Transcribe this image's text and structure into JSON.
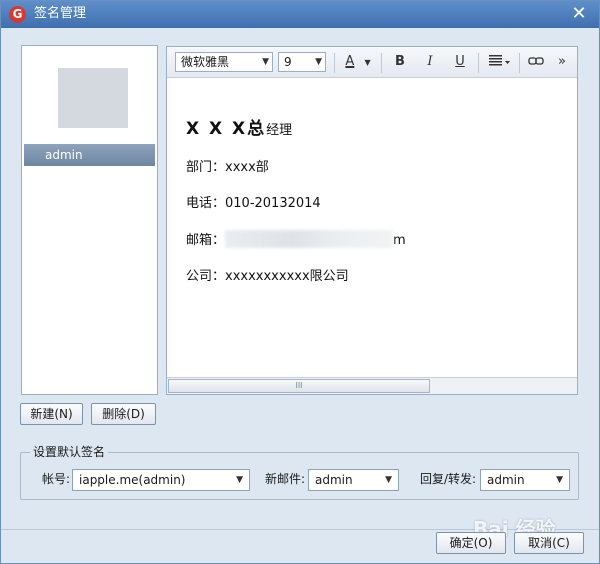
{
  "window": {
    "title": "签名管理",
    "app_icon_letter": "G"
  },
  "signature_list": {
    "items": [
      {
        "label": "admin"
      }
    ]
  },
  "toolbar": {
    "font_family": "微软雅黑",
    "font_size": "9",
    "font_color_glyph": "A",
    "bold_glyph": "B",
    "italic_glyph": "I",
    "underline_glyph": "U",
    "more_glyph": "»"
  },
  "signature": {
    "name": "X X X",
    "title_bold": "总",
    "title_suffix": "经理",
    "dept_label": "部门：",
    "dept_value": "xxxx部",
    "phone_label": "电话：",
    "phone_value": "010-20132014",
    "email_label": "邮箱：",
    "email_tail": "m",
    "company_label": "公司：",
    "company_value": "xxxxxxxxxxx限公司"
  },
  "scrollbar": {
    "grip": "III"
  },
  "buttons": {
    "new": "新建(N)",
    "delete": "删除(D)",
    "ok": "确定(O)",
    "cancel": "取消(C)"
  },
  "defaults": {
    "group_title": "设置默认签名",
    "account_label": "帐号:",
    "account_value": "iapple.me(admin)",
    "new_mail_label": "新邮件:",
    "new_mail_value": "admin",
    "reply_label": "回复/转发:",
    "reply_value": "admin"
  },
  "watermark": "Bai 经验"
}
